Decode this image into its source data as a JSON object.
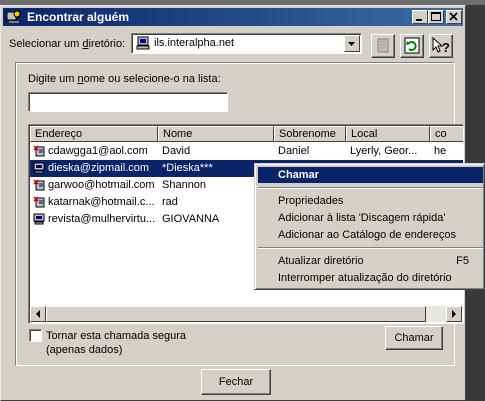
{
  "window": {
    "title": "Encontrar alguém"
  },
  "directory": {
    "label_prefix": "Selecionar um ",
    "label_underlined": "d",
    "label_suffix": "iretório:",
    "value": "ils.interalpha.net"
  },
  "search": {
    "label_prefix": "Digite um ",
    "label_underlined": "n",
    "label_suffix": "ome ou selecione-o na lista:",
    "value": ""
  },
  "list": {
    "columns": [
      "Endereço",
      "Nome",
      "Sobrenome",
      "Local",
      "co"
    ],
    "rows": [
      {
        "icon": "person-star-icon",
        "address": "cdawgga1@aol.com",
        "name": "David",
        "surname": "Daniel",
        "location": "Lyerly, Geor...",
        "extra": "he"
      },
      {
        "icon": "computer-icon",
        "address": "dieska@zipmail.com",
        "name": "*Dieska***",
        "surname": "",
        "location": "",
        "extra": "",
        "selected": true
      },
      {
        "icon": "person-star-icon",
        "address": "garwoo@hotmail.com",
        "name": "Shannon",
        "surname": "",
        "location": "",
        "extra": ""
      },
      {
        "icon": "person-star-icon",
        "address": "katarnak@hotmail.c...",
        "name": "rad",
        "surname": "",
        "location": "",
        "extra": ""
      },
      {
        "icon": "computer-icon",
        "address": "revista@mulhervirtu...",
        "name": "GIOVANNA",
        "surname": "",
        "location": "",
        "extra": ""
      }
    ]
  },
  "context_menu": {
    "call": "Chamar",
    "properties": "Propriedades",
    "add_speed_dial": "Adicionar à lista 'Discagem rápida'",
    "add_address_book": "Adicionar ao Catálogo de endereços",
    "refresh_directory": "Atualizar diretório",
    "refresh_shortcut": "F5",
    "stop_refresh": "Interromper atualização do diretório"
  },
  "secure_call": {
    "line1": "Tornar esta chamada segura",
    "line2": "(apenas dados)",
    "checked": false
  },
  "buttons": {
    "call": "Chamar",
    "close": "Fechar"
  }
}
